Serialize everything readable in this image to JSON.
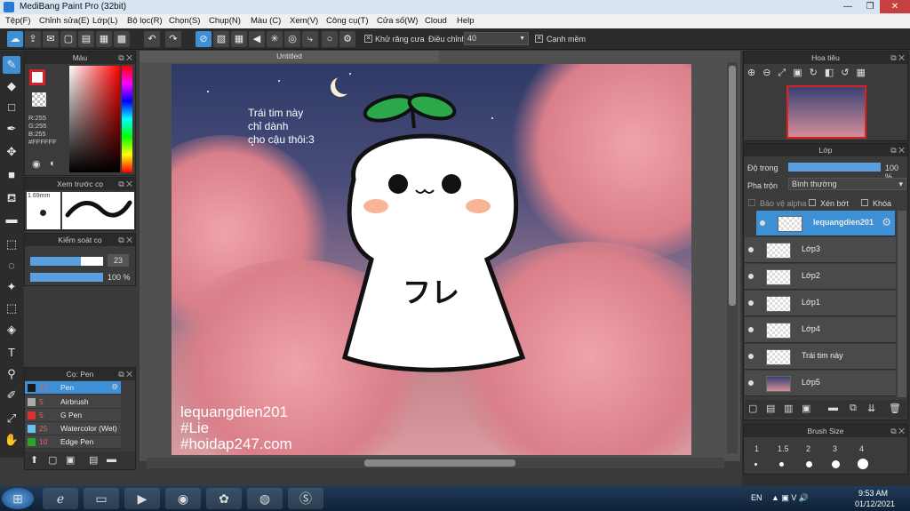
{
  "window": {
    "title": "MediBang Paint Pro (32bit)",
    "min": "—",
    "max": "❐",
    "close": "✕"
  },
  "menu": [
    "Tệp(F)",
    "Chỉnh sửa(E)",
    "Lớp(L)",
    "Bộ lọc(R)",
    "Chọn(S)",
    "Chụp(N)",
    "Màu (C)",
    "Xem(V)",
    "Công cụ(T)",
    "Cửa số(W)",
    "Cloud",
    "Help"
  ],
  "toolbar": {
    "antialias_label": "Khử răng cưa",
    "adjust_label": "Điều chỉnh",
    "adjust_value": "40",
    "snap_label": "Cạnh mềm"
  },
  "color_panel": {
    "title": "Màu",
    "r": "R:255",
    "g": "G:255",
    "b": "B:255",
    "hex": "#FFFFFF",
    "fg": "#d6202a",
    "bg": "#ffffff"
  },
  "preview_panel": {
    "title": "Xem trước cọ",
    "size": "1.69mm"
  },
  "control_panel": {
    "title": "Kiểm soát cọ",
    "size_value": "23",
    "opacity_value": "100 %",
    "size_fraction": 0.7,
    "opacity_fraction": 1.0
  },
  "brush_panel": {
    "title": "Cọ: Pen",
    "items": [
      {
        "size": "23",
        "name": "Pen",
        "color": "#1a1a1a",
        "selected": true
      },
      {
        "size": "5",
        "name": "Airbrush",
        "color": "#aaaaaa",
        "selected": false
      },
      {
        "size": "5",
        "name": "G Pen",
        "color": "#e03030",
        "selected": false
      },
      {
        "size": "25",
        "name": "Watercolor (Wet)",
        "color": "#6cc0f0",
        "selected": false
      },
      {
        "size": "10",
        "name": "Edge Pen",
        "color": "#28a428",
        "selected": false
      }
    ]
  },
  "canvas": {
    "tab_title": "Untitled",
    "text_heart": "Trái tim này\nchỉ dành\ncho cậu thôi:3",
    "watermark_1": "lequangdien201",
    "watermark_2": "#Lie",
    "watermark_3": "#hoidap247.com",
    "character_text": "フレ"
  },
  "navigator": {
    "title": "Hoa tiêu"
  },
  "layer_panel": {
    "title": "Lớp",
    "opacity_label": "Độ trong",
    "opacity_value": "100 %",
    "opacity_fraction": 1.0,
    "blend_label": "Pha trộn",
    "blend_value": "Bình thường",
    "protect_alpha": "Bảo vệ alpha",
    "clip": "Xén bớt",
    "lock": "Khóa",
    "layers": [
      {
        "name": "lequangdien201",
        "selected": true
      },
      {
        "name": "Lớp3",
        "selected": false
      },
      {
        "name": "Lớp2",
        "selected": false
      },
      {
        "name": "Lớp1",
        "selected": false
      },
      {
        "name": "Lớp4",
        "selected": false
      },
      {
        "name": "Trái tim này",
        "selected": false
      },
      {
        "name": "Lớp5",
        "selected": false
      }
    ]
  },
  "brush_size_panel": {
    "title": "Brush Size",
    "sizes": [
      "1",
      "1.5",
      "2",
      "3",
      "4"
    ]
  },
  "taskbar": {
    "lang": "EN",
    "time": "9:53 AM",
    "date": "01/12/2021"
  }
}
